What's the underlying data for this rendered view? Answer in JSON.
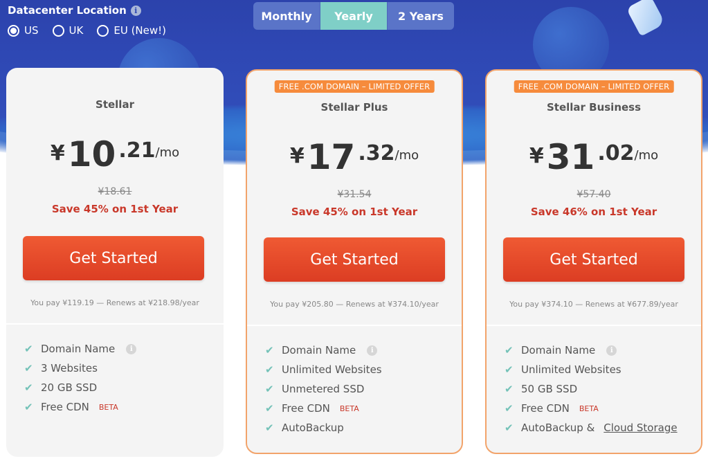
{
  "datacenter": {
    "title": "Datacenter Location",
    "info_icon": "i",
    "options": [
      {
        "label": "US",
        "selected": true
      },
      {
        "label": "UK",
        "selected": false
      },
      {
        "label": "EU (New!)",
        "selected": false
      }
    ]
  },
  "billing": {
    "options": [
      {
        "label": "Monthly",
        "active": false
      },
      {
        "label": "Yearly",
        "active": true
      },
      {
        "label": "2 Years",
        "active": false
      }
    ]
  },
  "plans": [
    {
      "badge": "",
      "name": "Stellar",
      "currency": "¥",
      "price_int": "10",
      "price_dec": ".21",
      "per": "/mo",
      "original": "¥18.61",
      "save": "Save 45% on 1st Year",
      "cta": "Get Started",
      "pay": "You pay ¥119.19 — Renews at ¥218.98/year",
      "features": [
        {
          "text": "Domain Name",
          "info": true
        },
        {
          "text": "3 Websites"
        },
        {
          "text": "20 GB SSD"
        },
        {
          "text": "Free CDN",
          "beta": "BETA"
        }
      ]
    },
    {
      "badge": "FREE .COM DOMAIN – LIMITED OFFER",
      "name": "Stellar Plus",
      "currency": "¥",
      "price_int": "17",
      "price_dec": ".32",
      "per": "/mo",
      "original": "¥31.54",
      "save": "Save 45% on 1st Year",
      "cta": "Get Started",
      "pay": "You pay ¥205.80 — Renews at ¥374.10/year",
      "features": [
        {
          "text": "Domain Name",
          "info": true
        },
        {
          "text": "Unlimited Websites"
        },
        {
          "text": "Unmetered SSD"
        },
        {
          "text": "Free CDN",
          "beta": "BETA"
        },
        {
          "text": "AutoBackup"
        }
      ]
    },
    {
      "badge": "FREE .COM DOMAIN – LIMITED OFFER",
      "name": "Stellar Business",
      "currency": "¥",
      "price_int": "31",
      "price_dec": ".02",
      "per": "/mo",
      "original": "¥57.40",
      "save": "Save 46% on 1st Year",
      "cta": "Get Started",
      "pay": "You pay ¥374.10 — Renews at ¥677.89/year",
      "features": [
        {
          "text": "Domain Name",
          "info": true
        },
        {
          "text": "Unlimited Websites"
        },
        {
          "text": "50 GB SSD"
        },
        {
          "text": "Free CDN",
          "beta": "BETA"
        },
        {
          "text": "AutoBackup &",
          "link": "Cloud Storage"
        }
      ]
    }
  ],
  "colors": {
    "hero": "#2e47b3",
    "cta": "#e24a2c",
    "accent_toggle": "#7fcfc7",
    "featured_border": "#f2a36a",
    "save_text": "#c9382a",
    "check": "#74c2b8"
  }
}
